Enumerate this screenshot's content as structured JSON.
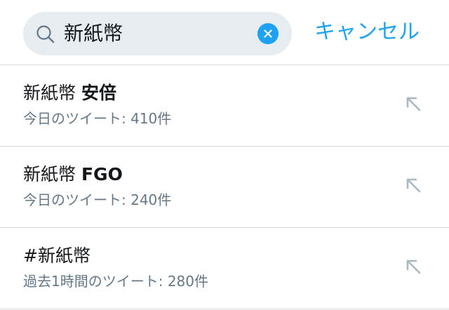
{
  "search": {
    "query": "新紙幣",
    "cancel_label": "キャンセル"
  },
  "suggestions": [
    {
      "prefix": "新紙幣",
      "bold": "安倍",
      "subtitle": "今日のツイート: 410件"
    },
    {
      "prefix": "新紙幣",
      "bold": "FGO",
      "subtitle": "今日のツイート: 240件"
    },
    {
      "prefix": "#新紙幣",
      "bold": "",
      "subtitle": "過去1時間のツイート: 280件"
    }
  ],
  "icons": {
    "search": "search-icon",
    "clear": "clear-icon",
    "fill_query": "arrow-up-left-icon"
  },
  "colors": {
    "accent": "#1da1f2",
    "search_bg": "#e6ecf0",
    "primary_text": "#14171a",
    "secondary_text": "#657786",
    "divider": "#d2d7dc"
  }
}
